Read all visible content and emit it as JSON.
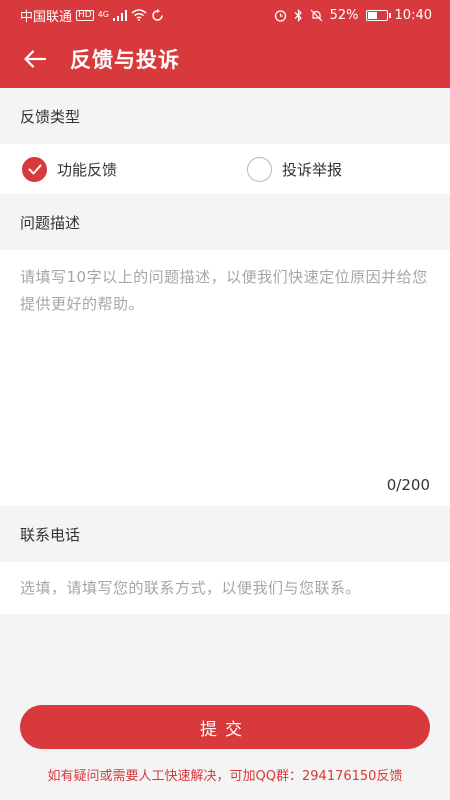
{
  "status_bar": {
    "carrier": "中国联通",
    "network_badge": "HD",
    "network_type": "4G",
    "battery_percent": "52%",
    "battery_level": 0.52,
    "time": "10:40",
    "icons": [
      "signal-icon",
      "wifi-icon",
      "alarm-icon",
      "bluetooth-icon",
      "mute-icon",
      "battery-icon"
    ]
  },
  "app_bar": {
    "title": "反馈与投诉",
    "back_icon": "arrow-left-icon"
  },
  "feedback_type": {
    "label": "反馈类型",
    "options": [
      {
        "label": "功能反馈",
        "checked": true
      },
      {
        "label": "投诉举报",
        "checked": false
      }
    ]
  },
  "description": {
    "label": "问题描述",
    "placeholder": "请填写10字以上的问题描述，以便我们快速定位原因并给您提供更好的帮助。",
    "counter": "0/200"
  },
  "contact": {
    "label": "联系电话",
    "placeholder": "选填，请填写您的联系方式，以便我们与您联系。"
  },
  "submit_label": "提交",
  "footer_note": "如有疑问或需要人工快速解决，可加QQ群：294176150反馈",
  "colors": {
    "accent": "#d8393c",
    "background": "#f4f4f4",
    "placeholder": "#a6a6a6"
  }
}
